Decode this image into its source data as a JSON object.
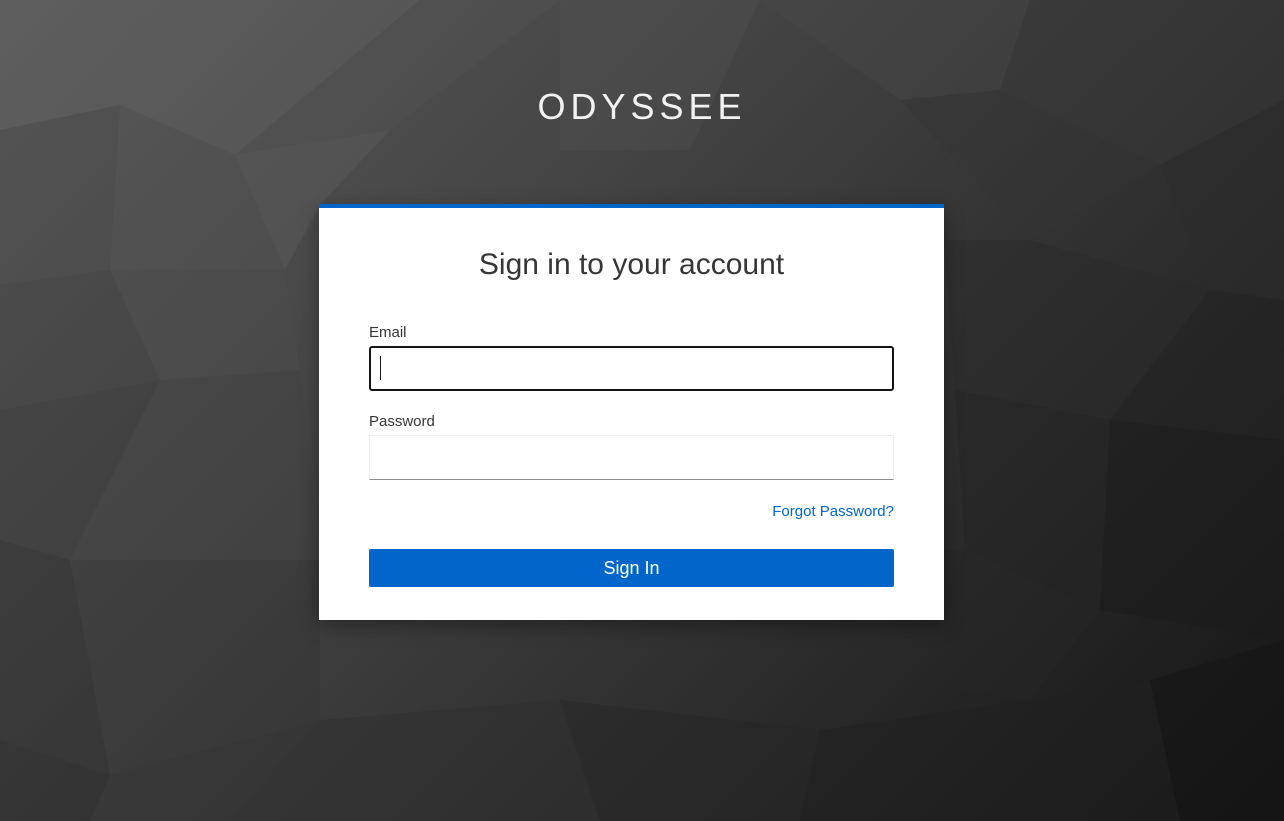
{
  "brand": {
    "name": "ODYSSEE"
  },
  "login": {
    "title": "Sign in to your account",
    "email_label": "Email",
    "email_value": "",
    "password_label": "Password",
    "password_value": "",
    "forgot_label": "Forgot Password?",
    "submit_label": "Sign In"
  },
  "colors": {
    "accent": "#0066cc",
    "card_bg": "#ffffff",
    "text": "#363636",
    "background_dark": "#141414",
    "background_light": "#5a5a5a"
  }
}
